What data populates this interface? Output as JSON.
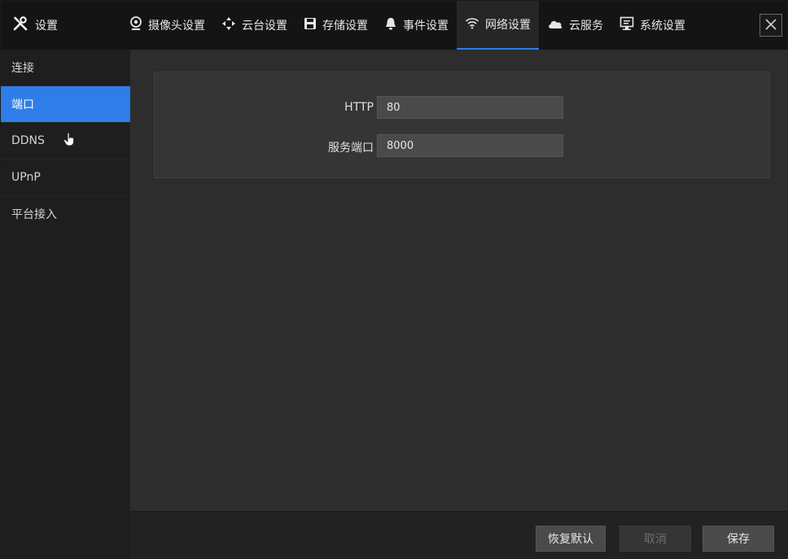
{
  "header": {
    "title": "设置",
    "tabs": [
      {
        "label": "摄像头设置",
        "icon": "camera-settings-icon"
      },
      {
        "label": "云台设置",
        "icon": "ptz-icon"
      },
      {
        "label": "存储设置",
        "icon": "save-disk-icon"
      },
      {
        "label": "事件设置",
        "icon": "bell-icon"
      },
      {
        "label": "网络设置",
        "icon": "wifi-icon",
        "active": true
      },
      {
        "label": "云服务",
        "icon": "cloud-icon"
      },
      {
        "label": "系统设置",
        "icon": "monitor-icon"
      }
    ]
  },
  "sidebar": {
    "items": [
      {
        "label": "连接"
      },
      {
        "label": "端口",
        "active": true
      },
      {
        "label": "DDNS"
      },
      {
        "label": "UPnP"
      },
      {
        "label": "平台接入"
      }
    ]
  },
  "form": {
    "http": {
      "label": "HTTP",
      "value": "80"
    },
    "service_port": {
      "label": "服务端口",
      "value": "8000"
    }
  },
  "footer": {
    "restore_label": "恢复默认",
    "cancel_label": "取消",
    "save_label": "保存"
  },
  "colors": {
    "accent": "#2f7de8",
    "topbar_bg": "#141414",
    "sidebar_bg": "#1e1e1e",
    "main_bg": "#2d2d2d"
  }
}
